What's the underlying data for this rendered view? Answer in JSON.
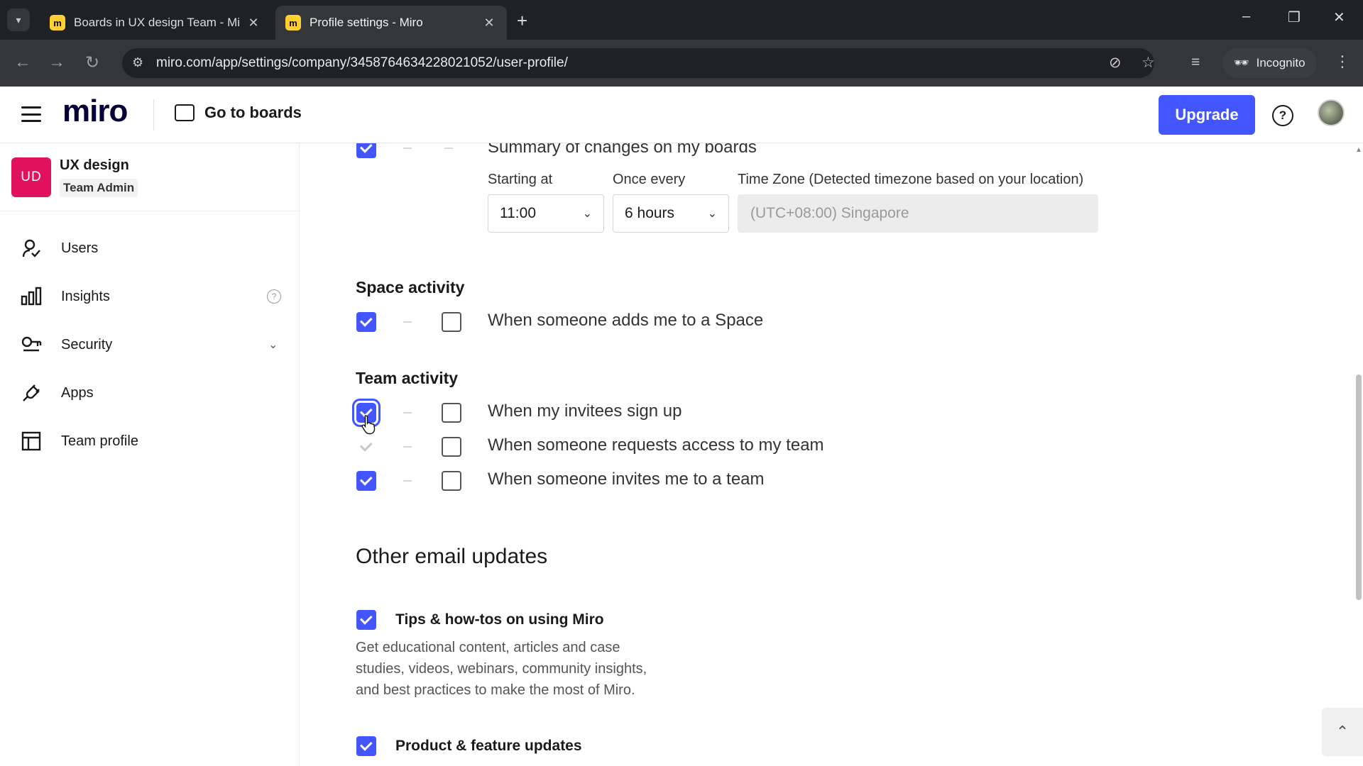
{
  "browser": {
    "tabs": [
      {
        "title": "Boards in UX design Team - Mi",
        "favicon": "miro-favicon"
      },
      {
        "title": "Profile settings - Miro",
        "favicon": "miro-favicon"
      }
    ],
    "url": "miro.com/app/settings/company/3458764634228021052/user-profile/",
    "incognito_label": "Incognito"
  },
  "header": {
    "logo": "miro",
    "go_to_boards": "Go to boards",
    "upgrade": "Upgrade",
    "help": "?"
  },
  "sidebar": {
    "team_initials": "UD",
    "team_name": "UX design",
    "team_role": "Team Admin",
    "items": [
      {
        "label": "Users",
        "icon": "user-icon"
      },
      {
        "label": "Insights",
        "icon": "bar-chart-icon"
      },
      {
        "label": "Security",
        "icon": "key-icon"
      },
      {
        "label": "Apps",
        "icon": "plug-icon"
      },
      {
        "label": "Team profile",
        "icon": "layout-icon"
      }
    ]
  },
  "main": {
    "summary": {
      "label": "Summary of changes on my boards",
      "starting_at_label": "Starting at",
      "starting_at_value": "11:00",
      "once_every_label": "Once every",
      "once_every_value": "6 hours",
      "timezone_label": "Time Zone  (Detected timezone based on your location)",
      "timezone_value": "(UTC+08:00) Singapore",
      "email_checked": true
    },
    "space_activity": {
      "title": "Space activity",
      "rows": [
        {
          "label": "When someone adds me to a Space",
          "email": true,
          "app": false
        }
      ]
    },
    "team_activity": {
      "title": "Team activity",
      "rows": [
        {
          "label": "When my invitees sign up",
          "email": true,
          "app": false
        },
        {
          "label": "When someone requests access to my team",
          "email": true,
          "app": false
        },
        {
          "label": "When someone invites me to a team",
          "email": true,
          "app": false
        }
      ]
    },
    "other_email": {
      "title": "Other email updates",
      "options": [
        {
          "title": "Tips & how-tos on using Miro",
          "desc": "Get educational content, articles and case studies, videos, webinars, community insights, and best practices to make the most of Miro.",
          "checked": true
        },
        {
          "title": "Product & feature updates",
          "checked": true
        }
      ]
    }
  },
  "colors": {
    "accent": "#4255ff",
    "team_badge": "#e0115f"
  }
}
